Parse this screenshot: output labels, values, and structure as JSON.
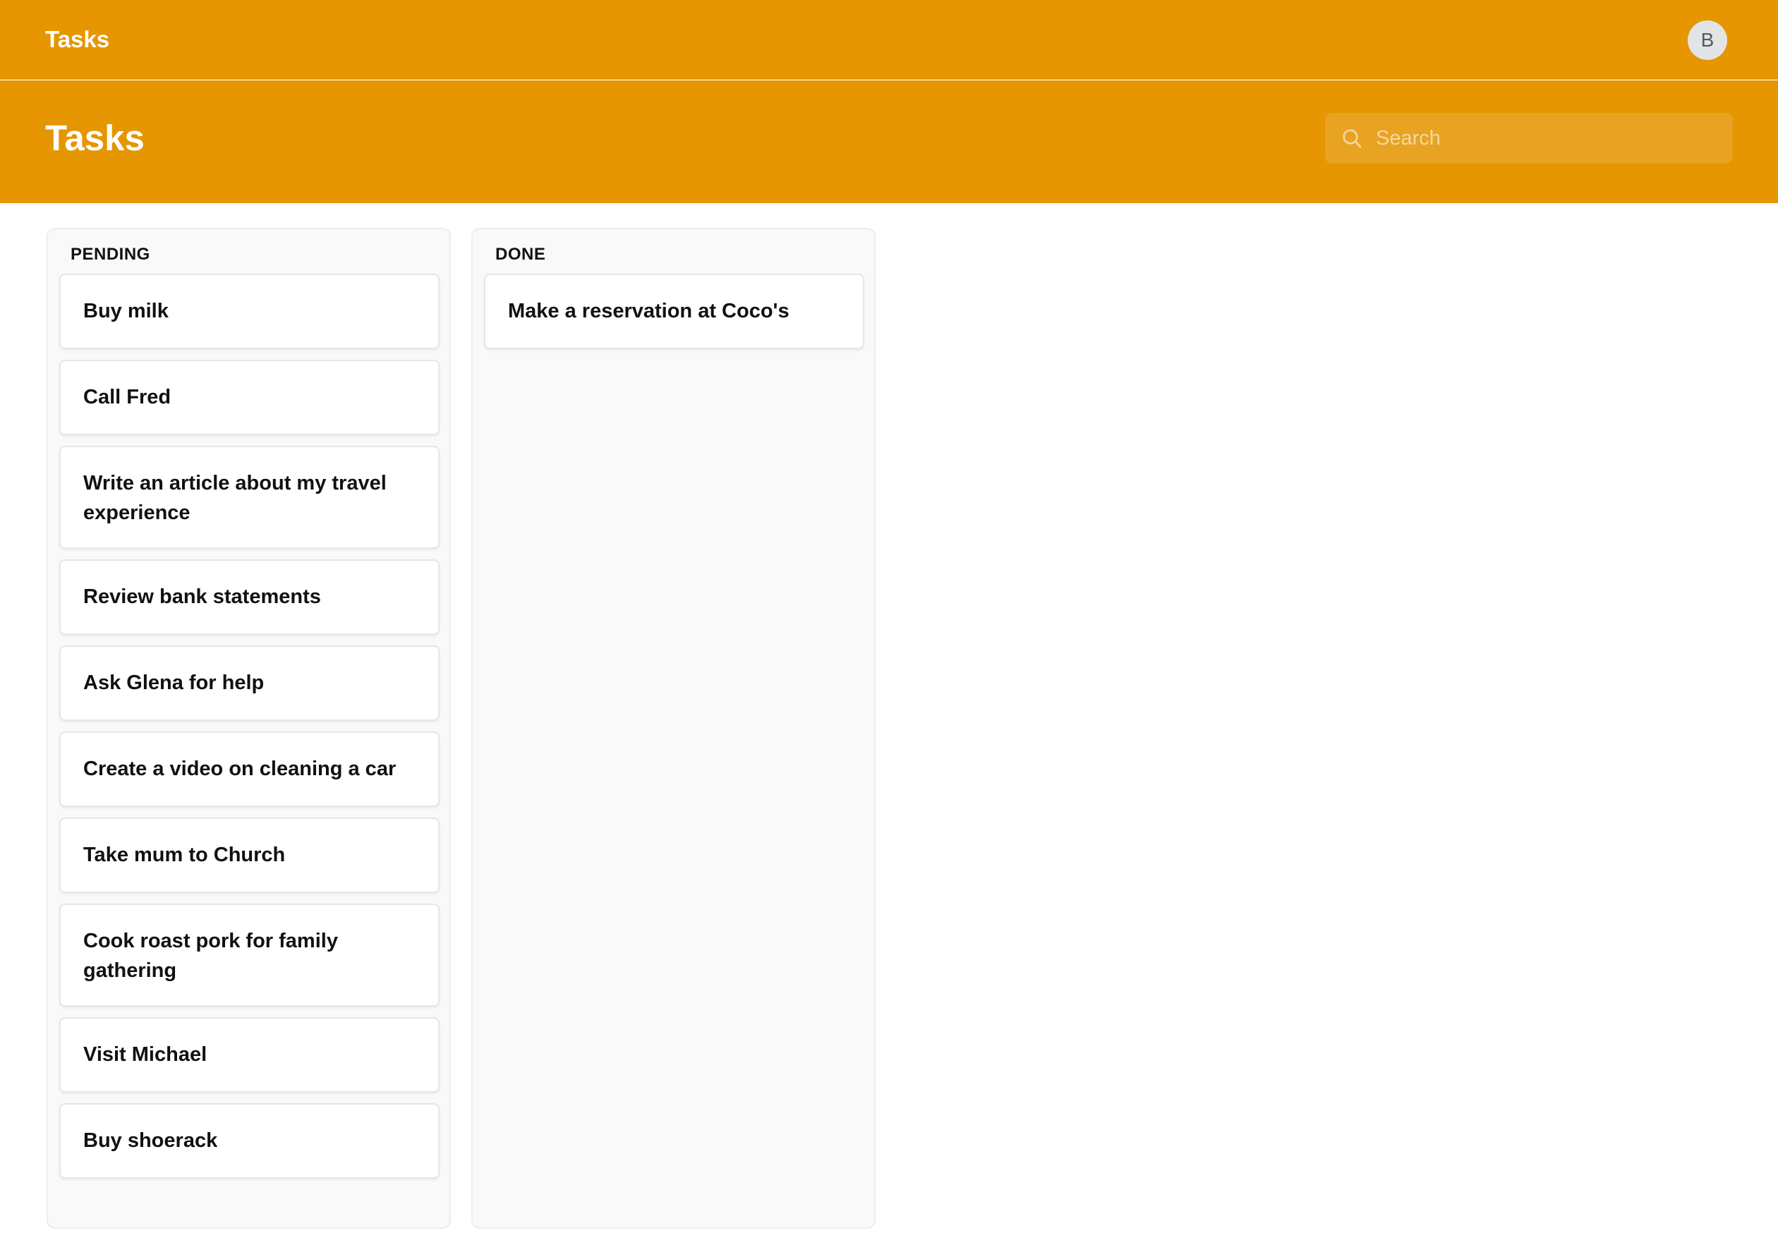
{
  "app": {
    "title": "Tasks",
    "avatar_initial": "B"
  },
  "header": {
    "title": "Tasks",
    "search": {
      "placeholder": "Search",
      "value": "",
      "icon": "search-icon"
    }
  },
  "colors": {
    "accent": "#e59600",
    "column_bg": "#f9f9f9",
    "card_bg": "#ffffff"
  },
  "columns": [
    {
      "title": "PENDING",
      "cards": [
        "Buy milk",
        "Call Fred",
        "Write an article about my travel experience",
        "Review bank statements",
        "Ask Glena for help",
        "Create a video on cleaning a car",
        "Take mum to Church",
        "Cook roast pork for family gathering",
        "Visit Michael",
        "Buy shoerack"
      ]
    },
    {
      "title": "DONE",
      "cards": [
        "Make a reservation at Coco's"
      ]
    }
  ]
}
